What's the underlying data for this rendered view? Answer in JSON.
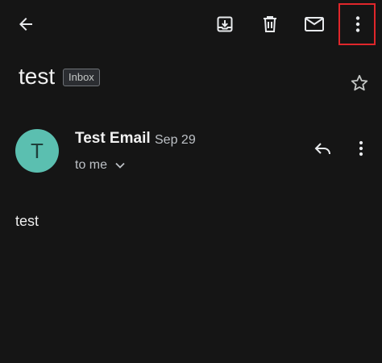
{
  "toolbar": {
    "icons": [
      "back-arrow-icon",
      "archive-icon",
      "delete-icon",
      "mark-unread-icon",
      "more-vert-icon"
    ]
  },
  "message": {
    "subject": "test",
    "label": "Inbox",
    "sender": "Test Email",
    "date": "Sep 29",
    "recipient": "to me",
    "avatar_letter": "T",
    "avatar_color": "#5bbfb0",
    "body": "test"
  },
  "colors": {
    "background": "#151515",
    "highlight": "#e0262b"
  }
}
